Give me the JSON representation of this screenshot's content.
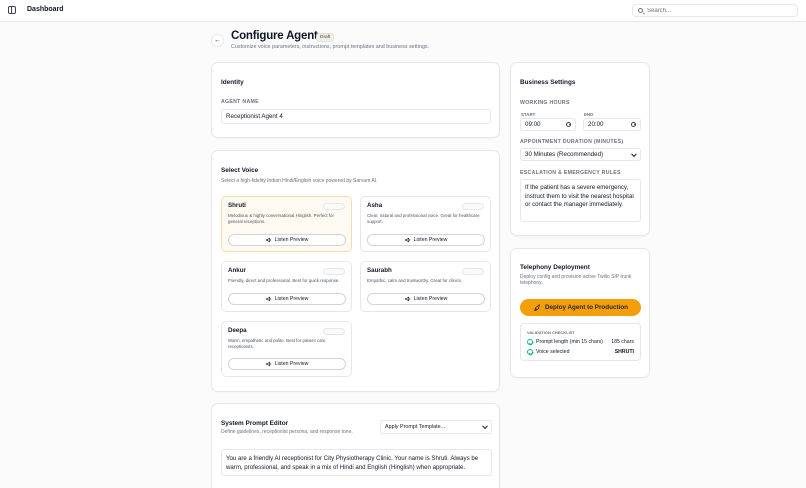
{
  "topbar": {
    "title": "Dashboard",
    "search_placeholder": "Search..."
  },
  "header": {
    "title": "Configure Agent",
    "badge": "Draft",
    "subtitle": "Customize voice parameters, instructions, prompt templates and business settings."
  },
  "identity": {
    "title": "Identity",
    "agent_name_label": "AGENT NAME",
    "agent_name_value": "Receptionist Agent 4"
  },
  "voice": {
    "title": "Select Voice",
    "subtitle": "Select a high-fidelity Indian Hindi/English voice powered by Sarvam AI.",
    "preview_label": "Listen Preview",
    "items": [
      {
        "name": "Shruti",
        "desc": "Melodious & highly conversational Hinglish. Perfect for general receptions.",
        "selected": true
      },
      {
        "name": "Asha",
        "desc": "Clear, natural and professional voice. Great for healthcare support.",
        "selected": false
      },
      {
        "name": "Ankur",
        "desc": "Friendly, direct and professional. Best for quick response.",
        "selected": false
      },
      {
        "name": "Saurabh",
        "desc": "Empathic, calm and trustworthy. Great for clinics.",
        "selected": false
      },
      {
        "name": "Deepa",
        "desc": "Warm, empathetic and polite. Best for patient care receptionists.",
        "selected": false
      }
    ]
  },
  "prompt": {
    "title": "System Prompt Editor",
    "subtitle": "Define guidelines, receptionist persona, and response tone.",
    "template_select": "Apply Prompt Template...",
    "text": "You are a friendly AI receptionist for City Physiotherapy Clinic. Your name is Shruti. Always be warm, professional, and speak in a mix of Hindi and English (Hinglish) when appropriate."
  },
  "business": {
    "title": "Business Settings",
    "working_hours_label": "WORKING HOURS",
    "start_label": "START",
    "start_value": "09:00",
    "end_label": "END",
    "end_value": "20:00",
    "duration_label": "APPOINTMENT DURATION (MINUTES)",
    "duration_value": "30 Minutes (Recommended)",
    "escalation_label": "ESCALATION & EMERGENCY RULES",
    "escalation_text": "If the patient has a severe emergency, instruct them to visit the nearest hospital or contact the manager immediately."
  },
  "telephony": {
    "title": "Telephony Deployment",
    "subtitle": "Deploy config and provision active Twilio SIP trunk telephony.",
    "deploy_label": "Deploy Agent to Production",
    "checklist_title": "VALIDATION CHECKLIST",
    "checks": [
      {
        "label": "Prompt length (min 15 chars)",
        "value": "185 chars"
      },
      {
        "label": "Voice selected",
        "value": "SHRUTI"
      }
    ]
  },
  "colors": {
    "accent": "#f59e0b",
    "selected_card_bg": "#fffaf1",
    "success": "#10b981"
  }
}
